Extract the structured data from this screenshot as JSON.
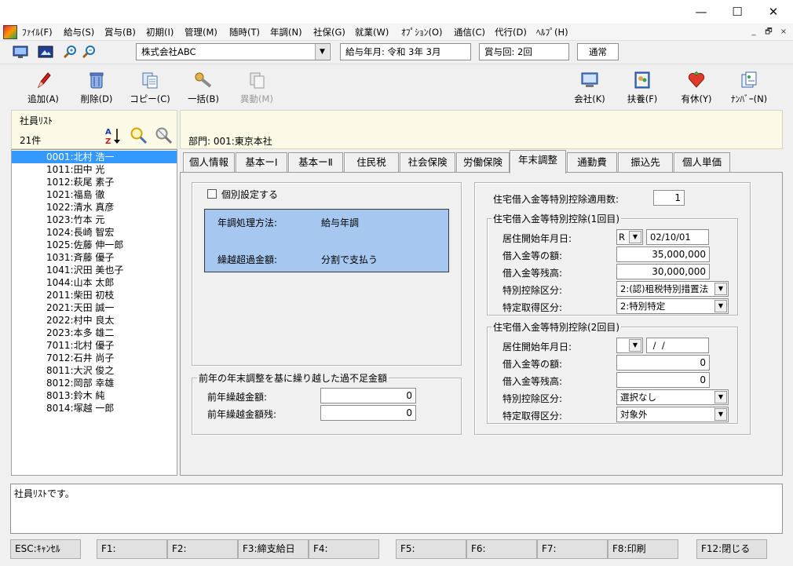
{
  "window": {
    "minimize_glyph": "—",
    "maximize_glyph": "☐",
    "close_glyph": "✕"
  },
  "menu": {
    "items": [
      "ﾌｧｲﾙ(F)",
      "給与(S)",
      "賞与(B)",
      "初期(I)",
      "管理(M)",
      "随時(T)",
      "年調(N)",
      "社保(G)",
      "就業(W)",
      "ｵﾌﾟｼｮﾝ(O)",
      "通信(C)",
      "代行(D)",
      "ﾍﾙﾌﾟ(H)"
    ],
    "mdi_controls": [
      "_",
      "🗗",
      "×"
    ]
  },
  "toolbar": {
    "company": "株式会社ABC",
    "pay_month": "給与年月: 令和  3年  3月",
    "bonus_round": "賞与回: 2回",
    "mode": "通常"
  },
  "actions": {
    "add": "追加(A)",
    "delete": "削除(D)",
    "copy": "コピー(C)",
    "bulk": "一括(B)",
    "transfer": "異動(M)",
    "company": "会社(K)",
    "dependents": "扶養(F)",
    "paid_leave": "有休(Y)",
    "number": "ﾅﾝﾊﾞｰ(N)"
  },
  "list": {
    "title": "社員ﾘｽﾄ",
    "count": "21件",
    "employees": [
      "0001:北村  浩一",
      "1011:田中  光",
      "1012:萩尾  素子",
      "1021:福島  徹",
      "1022:清水  真彦",
      "1023:竹本  元",
      "1024:長崎  智宏",
      "1025:佐藤  伸一郎",
      "1031:斉藤  優子",
      "1041:沢田  美也子",
      "1044:山本  太郎",
      "2011:柴田  初枝",
      "2021:天田  誠一",
      "2022:村中  良太",
      "2023:本多  雄二",
      "7011:北村  優子",
      "7012:石井  尚子",
      "8011:大沢  俊之",
      "8012:岡部  幸雄",
      "8013:鈴木  純",
      "8014:塚越  一郎"
    ],
    "selected_index": 0
  },
  "department": "部門:  001:東京本社",
  "tabs": [
    "個人情報",
    "基本ーⅠ",
    "基本ーⅡ",
    "住民税",
    "社会保険",
    "労働保険",
    "年末調整",
    "通勤費",
    "振込先",
    "個人単価"
  ],
  "active_tab": 6,
  "year_end": {
    "individual_setting_label": "個別設定する",
    "method_label": "年調処理方法:",
    "method_value": "給与年調",
    "excess_label": "繰越超過金額:",
    "excess_value": "分割で支払う",
    "prev_group_title": "前年の年末調整を基に繰り越した過不足金額",
    "prev_carry_label": "前年繰越金額:",
    "prev_carry_value": "0",
    "prev_remain_label": "前年繰越金額残:",
    "prev_remain_value": "0"
  },
  "housing_loan": {
    "count_label": "住宅借入金等特別控除適用数:",
    "count_value": "1",
    "first": {
      "title": "住宅借入金等特別控除(1回目)",
      "start_label": "居住開始年月日:",
      "era": "R",
      "start_date": "02/10/01",
      "amount_label": "借入金等の額:",
      "amount_value": "35,000,000",
      "balance_label": "借入金等残高:",
      "balance_value": "30,000,000",
      "special_label": "特別控除区分:",
      "special_value": "2:(認)租税特別措置法",
      "acquisition_label": "特定取得区分:",
      "acquisition_value": "2:特別特定"
    },
    "second": {
      "title": "住宅借入金等特別控除(2回目)",
      "start_label": "居住開始年月日:",
      "era": "",
      "start_date": " /  /",
      "amount_label": "借入金等の額:",
      "amount_value": "0",
      "balance_label": "借入金等残高:",
      "balance_value": "0",
      "special_label": "特別控除区分:",
      "special_value": "選択なし",
      "acquisition_label": "特定取得区分:",
      "acquisition_value": "対象外"
    }
  },
  "status_text": "社員ﾘｽﾄです。",
  "fkeys": [
    "ESC:ｷｬﾝｾﾙ",
    "F1:",
    "F2:",
    "F3:締支給日",
    "F4:",
    "F5:",
    "F6:",
    "F7:",
    "F8:印刷",
    "F12:閉じる"
  ]
}
